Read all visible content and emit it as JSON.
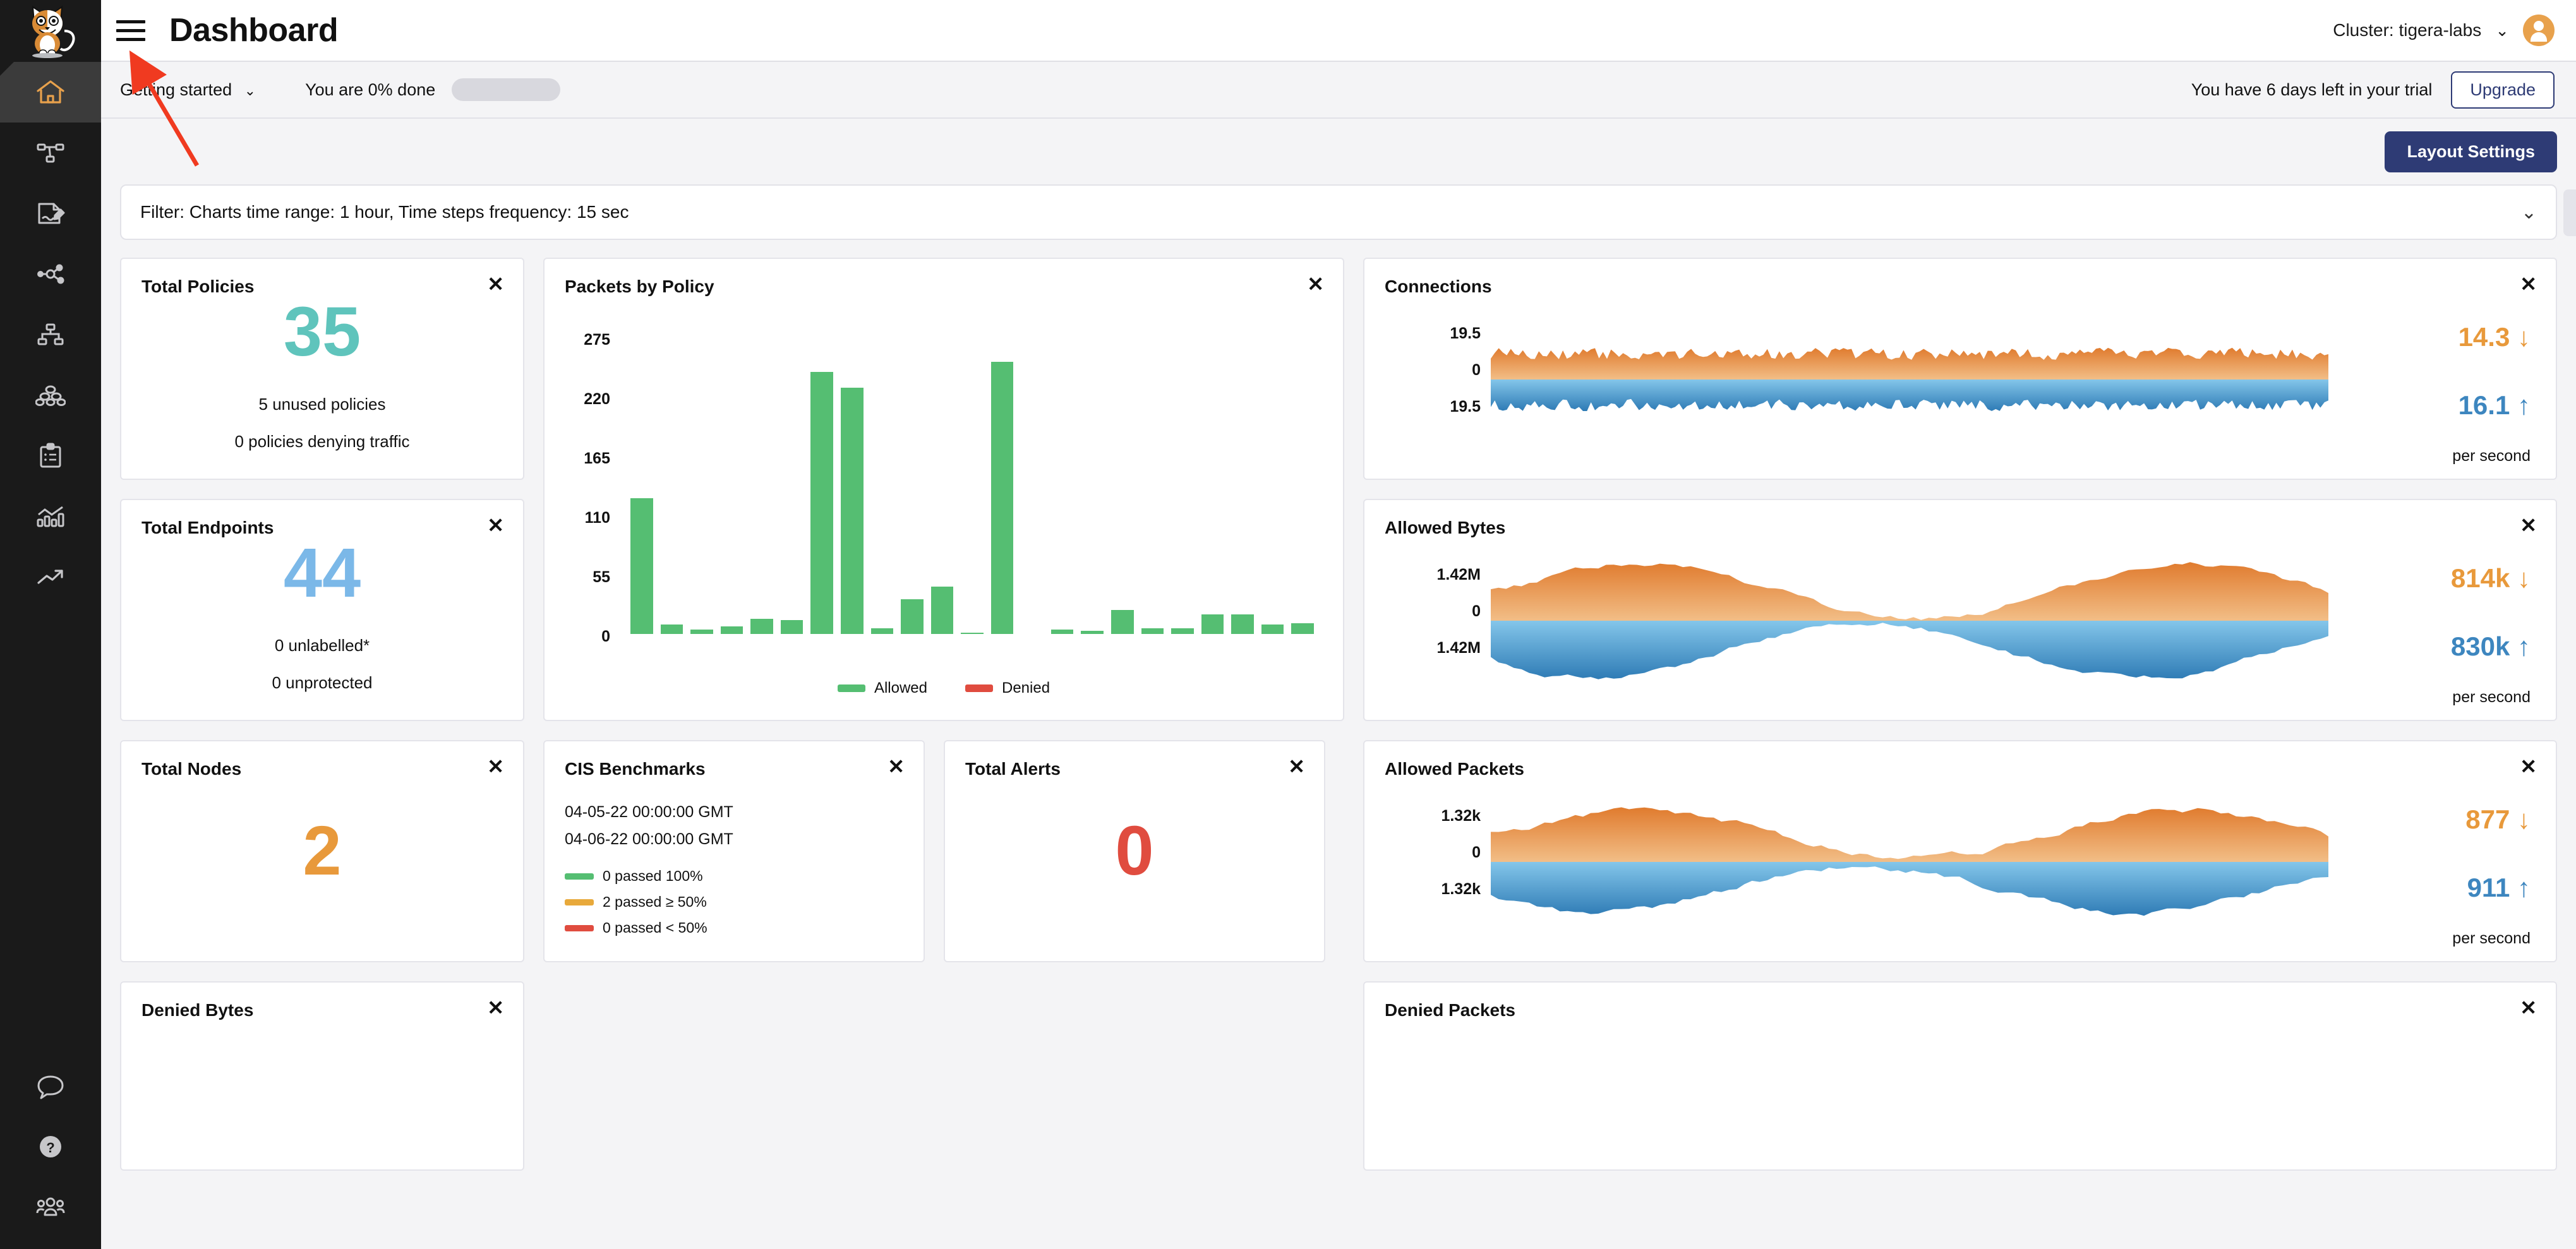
{
  "app": {
    "title": "Dashboard",
    "logo_alt": "calico-cat-logo"
  },
  "topbar": {
    "cluster_label": "Cluster: tigera-labs",
    "chevron": "⌄"
  },
  "trial": {
    "getting_started": "Getting started",
    "chevron": "⌄",
    "done_text": "You are 0% done",
    "progress_percent": 0,
    "trial_text": "You have 6 days left in your trial",
    "upgrade_label": "Upgrade"
  },
  "toolbar": {
    "layout_settings_label": "Layout Settings"
  },
  "filter": {
    "text": "Filter: Charts time range: 1 hour, Time steps frequency: 15 sec",
    "chevron": "⌄",
    "clear": "✕"
  },
  "close_glyph": "✕",
  "colors": {
    "teal": "#5FC4BC",
    "blue": "#7BB8E8",
    "orange": "#E8993B",
    "red": "#E04C3F",
    "green": "#55BE72",
    "navy": "#2E3B75",
    "area_up": "#E8993B",
    "area_down": "#3D86BF"
  },
  "cards": {
    "total_policies": {
      "title": "Total Policies",
      "value": "35",
      "sub1": "5 unused policies",
      "sub2": "0 policies denying traffic"
    },
    "total_endpoints": {
      "title": "Total Endpoints",
      "value": "44",
      "sub1": "0 unlabelled*",
      "sub2": "0 unprotected"
    },
    "total_nodes": {
      "title": "Total Nodes",
      "value": "2"
    },
    "total_alerts": {
      "title": "Total Alerts",
      "value": "0"
    },
    "cis_benchmarks": {
      "title": "CIS Benchmarks",
      "date_from": "04-05-22 00:00:00 GMT",
      "date_to": "04-06-22 00:00:00 GMT",
      "legend": [
        {
          "color": "#55BE72",
          "text": "0 passed 100%"
        },
        {
          "color": "#E8A93B",
          "text": "2 passed ≥ 50%"
        },
        {
          "color": "#E04C3F",
          "text": "0 passed < 50%"
        }
      ]
    },
    "packets_by_policy": {
      "title": "Packets by Policy"
    },
    "connections": {
      "title": "Connections"
    },
    "allowed_bytes": {
      "title": "Allowed Bytes"
    },
    "allowed_packets": {
      "title": "Allowed Packets"
    },
    "denied_bytes": {
      "title": "Denied Bytes"
    },
    "denied_packets": {
      "title": "Denied Packets"
    }
  },
  "sidebar": {
    "items": [
      {
        "name": "home",
        "label": "Dashboard",
        "active": true
      },
      {
        "name": "policies",
        "label": "Policies",
        "active": false
      },
      {
        "name": "policy-editor",
        "label": "Policy Editor",
        "active": false
      },
      {
        "name": "service-graph",
        "label": "Service Graph",
        "active": false
      },
      {
        "name": "nodes",
        "label": "Nodes",
        "active": false
      },
      {
        "name": "endpoints",
        "label": "Endpoints",
        "active": false
      },
      {
        "name": "compliance",
        "label": "Compliance",
        "active": false
      },
      {
        "name": "metrics",
        "label": "Metrics",
        "active": false
      },
      {
        "name": "timeline",
        "label": "Timeline",
        "active": false
      }
    ],
    "bottom_items": [
      {
        "name": "feedback",
        "label": "Feedback"
      },
      {
        "name": "help",
        "label": "Help"
      },
      {
        "name": "team",
        "label": "Team"
      }
    ]
  },
  "chart_data": [
    {
      "id": "packets-by-policy",
      "type": "bar",
      "title": "Packets by Policy",
      "xlabel": "",
      "ylabel": "",
      "ylim": [
        0,
        275
      ],
      "yticks": [
        0,
        55,
        110,
        165,
        220,
        275
      ],
      "grid": false,
      "legend_position": "bottom",
      "legend": [
        {
          "name": "Allowed",
          "color": "#55BE72"
        },
        {
          "name": "Denied",
          "color": "#E04C3F"
        }
      ],
      "series": [
        {
          "name": "Allowed",
          "color": "#55BE72",
          "values": [
            126,
            9,
            4,
            7,
            14,
            13,
            243,
            228,
            5,
            32,
            44,
            1,
            252,
            null,
            4,
            3,
            22,
            5,
            5,
            18,
            18,
            9,
            10
          ]
        },
        {
          "name": "Denied",
          "color": "#E04C3F",
          "values": []
        }
      ]
    },
    {
      "id": "connections",
      "type": "area",
      "title": "Connections",
      "mirrored": true,
      "yticks_top": "19.5",
      "yticks_mid": "0",
      "yticks_bottom": "19.5",
      "ylim": [
        -19.5,
        19.5
      ],
      "value_in": "14.3",
      "value_in_arrow": "↓",
      "value_out": "16.1",
      "value_out_arrow": "↑",
      "unit": "per second",
      "series": [
        {
          "name": "inbound",
          "color": "#E8993B",
          "direction": "up"
        },
        {
          "name": "outbound",
          "color": "#3D86BF",
          "direction": "down"
        }
      ]
    },
    {
      "id": "allowed-bytes",
      "type": "area",
      "title": "Allowed Bytes",
      "mirrored": true,
      "yticks_top": "1.42M",
      "yticks_mid": "0",
      "yticks_bottom": "1.42M",
      "value_in": "814k",
      "value_in_arrow": "↓",
      "value_out": "830k",
      "value_out_arrow": "↑",
      "unit": "per second",
      "series": [
        {
          "name": "inbound",
          "color": "#E8993B",
          "direction": "up"
        },
        {
          "name": "outbound",
          "color": "#3D86BF",
          "direction": "down"
        }
      ]
    },
    {
      "id": "allowed-packets",
      "type": "area",
      "title": "Allowed Packets",
      "mirrored": true,
      "yticks_top": "1.32k",
      "yticks_mid": "0",
      "yticks_bottom": "1.32k",
      "value_in": "877",
      "value_in_arrow": "↓",
      "value_out": "911",
      "value_out_arrow": "↑",
      "unit": "per second",
      "series": [
        {
          "name": "inbound",
          "color": "#E8993B",
          "direction": "up"
        },
        {
          "name": "outbound",
          "color": "#3D86BF",
          "direction": "down"
        }
      ]
    }
  ]
}
